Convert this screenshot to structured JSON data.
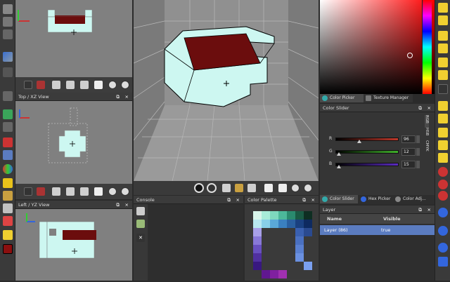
{
  "views": {
    "top_label": "Top / XZ View",
    "left_label": "Left / YZ View"
  },
  "console": {
    "title": "Console"
  },
  "palette": {
    "title": "Color Palette"
  },
  "color_picker": {
    "tab_picker": "Color Picker",
    "tab_texture": "Texture Manager"
  },
  "color_slider": {
    "title": "Color Slider",
    "modes": [
      "RGB",
      "HSB",
      "CMYK"
    ],
    "channels": [
      {
        "label": "R",
        "value": "96",
        "color": "#c0392b",
        "level": 0.38
      },
      {
        "label": "G",
        "value": "12",
        "color": "#3fae2a",
        "level": 0.05
      },
      {
        "label": "B",
        "value": "15",
        "color": "#5a2bc0",
        "level": 0.06
      }
    ],
    "tab_slider": "Color Slider",
    "tab_hex": "Hex Picker",
    "tab_adj": "Color Adj..."
  },
  "layer": {
    "title": "Layer",
    "col_name": "Name",
    "col_visible": "Visible",
    "rows": [
      {
        "name": "Layer (86)",
        "visible": "true"
      }
    ]
  },
  "colors": {
    "voxel": "#cdf7f1",
    "dark_red": "#6b0d0d",
    "selected_swatch": "#8b0f0f",
    "accent_blue": "#5b7cc0"
  }
}
